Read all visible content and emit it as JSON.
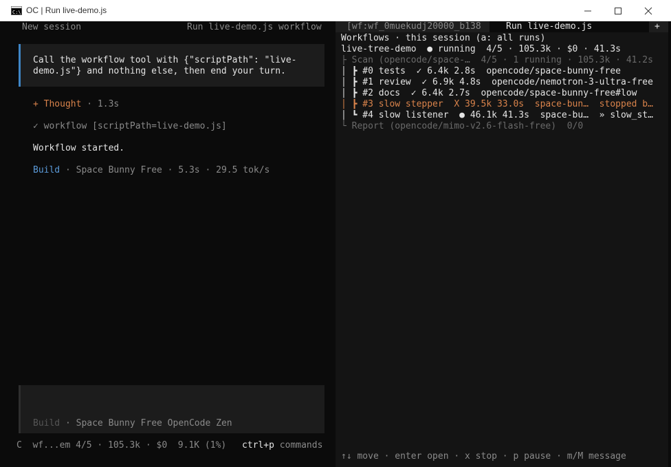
{
  "window": {
    "title": "OC | Run live-demo.js"
  },
  "left": {
    "header_left": "New session",
    "header_right": "Run live-demo.js workflow",
    "user_prompt_line1": "Call the workflow tool with {\"scriptPath\": \"live-",
    "user_prompt_line2": "demo.js\"} and nothing else, then end your turn.",
    "thought_label": "+ Thought",
    "thought_time": " · 1.3s",
    "tool_call": "✓ workflow [scriptPath=live-demo.js]",
    "result": "Workflow started.",
    "model_mode": "Build",
    "model_info": " · Space Bunny Free · 5.3s · 29.5 tok/s",
    "input_mode": "Build",
    "input_model": " · Space Bunny Free OpenCode Zen",
    "status_left": "C  wf...em 4/5 · 105.3k · $0  9.1K (1%)",
    "status_key": "ctrl+p",
    "status_cmd": " commands"
  },
  "right": {
    "tab_inactive": "[wf:wf_0muekudj20000_b138",
    "tab_active": "Run live-demo.js",
    "tab_plus": "+",
    "header": "Workflows · this session (a: all runs)",
    "run_line": "live-tree-demo  ● running  4/5 · 105.3k · $0 · 41.3s",
    "scan_line": "├ Scan (opencode/space-…  4/5 · 1 running · 105.3k · 41.2s",
    "tasks": [
      {
        "text": "│ ┣ #0 tests  ✓ 6.4k 2.8s  opencode/space-bunny-free",
        "status": "done"
      },
      {
        "text": "│ ┣ #1 review  ✓ 6.9k 4.8s  opencode/nemotron-3-ultra-free",
        "status": "done"
      },
      {
        "text": "│ ┣ #2 docs  ✓ 6.4k 2.7s  opencode/space-bunny-free#low",
        "status": "done"
      },
      {
        "text": "│ ┣ #3 slow stepper  X 39.5k 33.0s  space-bun…  stopped b…",
        "status": "stopped"
      },
      {
        "text": "│ ┗ #4 slow listener  ● 46.1k 41.3s  space-bu…  » slow_st…",
        "status": "running"
      }
    ],
    "report_line": "└ Report (opencode/mimo-v2.6-flash-free)  0/0",
    "help": "↑↓ move · enter open · x stop · p pause · m/M message"
  }
}
